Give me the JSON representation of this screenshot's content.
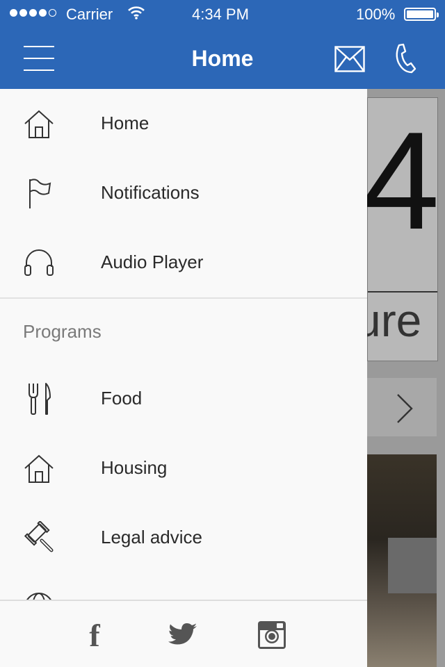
{
  "status_bar": {
    "carrier": "Carrier",
    "time": "4:34 PM",
    "battery": "100%"
  },
  "nav": {
    "title": "Home",
    "icons": [
      "hamburger-icon",
      "mail-icon",
      "phone-icon"
    ]
  },
  "drawer": {
    "items": [
      {
        "label": "Home",
        "icon": "home-icon"
      },
      {
        "label": "Notifications",
        "icon": "flag-icon"
      },
      {
        "label": "Audio Player",
        "icon": "headphones-icon"
      }
    ],
    "section_title": "Programs",
    "program_items": [
      {
        "label": "Food",
        "icon": "fork-knife-icon"
      },
      {
        "label": "Housing",
        "icon": "house-icon"
      },
      {
        "label": "Legal advice",
        "icon": "gavel-icon"
      }
    ]
  },
  "footer": {
    "social": [
      "facebook-icon",
      "twitter-icon",
      "instagram-icon"
    ],
    "facebook_glyph": "f"
  },
  "background": {
    "big_text": "4",
    "partial_text": "ure"
  },
  "colors": {
    "brand": "#2c67b7",
    "drawer_bg": "#f9f9f9",
    "text": "#2a2a2a",
    "section": "#7a7a7a"
  }
}
